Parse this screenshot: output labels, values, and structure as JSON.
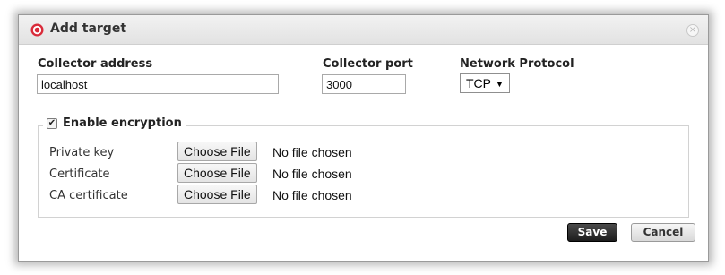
{
  "dialog": {
    "title": "Add target",
    "close_glyph": "×",
    "title_icon": "target-icon",
    "accent_color": "#d92b3a"
  },
  "form": {
    "collector_address": {
      "label": "Collector address",
      "value": "localhost"
    },
    "collector_port": {
      "label": "Collector port",
      "value": "3000"
    },
    "network_protocol": {
      "label": "Network Protocol",
      "selected": "TCP"
    }
  },
  "encryption": {
    "label": "Enable encryption",
    "checked": true,
    "check_glyph": "✔",
    "rows": [
      {
        "label": "Private key",
        "button": "Choose File",
        "status": "No file chosen"
      },
      {
        "label": "Certificate",
        "button": "Choose File",
        "status": "No file chosen"
      },
      {
        "label": "CA certificate",
        "button": "Choose File",
        "status": "No file chosen"
      }
    ]
  },
  "actions": {
    "save_label": "Save",
    "cancel_label": "Cancel"
  }
}
